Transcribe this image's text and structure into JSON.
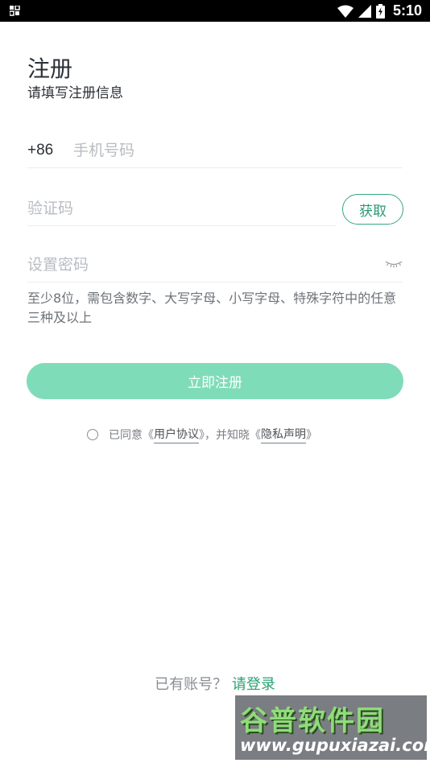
{
  "status_bar": {
    "time": "5:10",
    "icons": [
      "notification-grid-icon",
      "wifi-icon",
      "signal-icon",
      "battery-icon"
    ]
  },
  "header": {
    "title": "注册",
    "subtitle": "请填写注册信息"
  },
  "form": {
    "phone": {
      "prefix": "+86",
      "placeholder": "手机号码",
      "value": ""
    },
    "code": {
      "placeholder": "验证码",
      "value": "",
      "get_button": "获取"
    },
    "password": {
      "placeholder": "设置密码",
      "value": "",
      "visibility_icon": "eye-closed-icon"
    },
    "hint": "至少8位，需包含数字、大写字母、小写字母、特殊字符中的任意三种及以上"
  },
  "register_button": "立即注册",
  "agreement": {
    "prefix": "已同意《",
    "user_agreement": "用户协议",
    "middle": "》，并知晓《",
    "privacy": "隐私声明",
    "suffix": "》"
  },
  "footer": {
    "question": "已有账号？",
    "login_link": "请登录"
  },
  "watermark": {
    "title": "谷普软件园",
    "url": "www.gupuxiazai.com"
  },
  "colors": {
    "accent": "#2aa272",
    "button_bg": "#7fdcb8",
    "text": "#2b2f36",
    "placeholder": "#b8bcc2"
  }
}
